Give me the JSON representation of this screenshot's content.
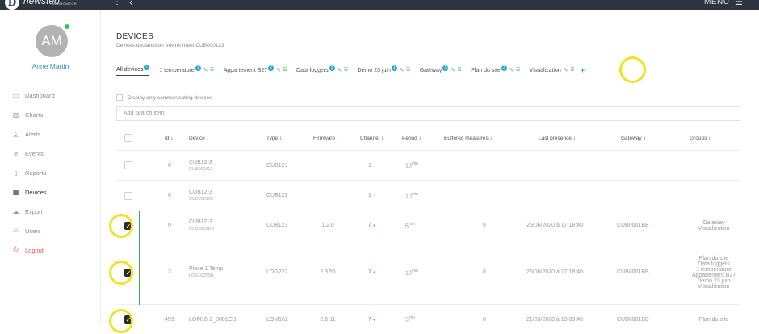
{
  "header": {
    "brand_name": "newsteo",
    "brand_sub": "WEBMONITOR",
    "brand_letter": "D",
    "menu_label": "MENU"
  },
  "user": {
    "initials": "AM",
    "name": "Anne Martin"
  },
  "sidebar": {
    "items": [
      {
        "label": "Dashboard",
        "icon": "monitor-icon"
      },
      {
        "label": "Charts",
        "icon": "bar-chart-icon"
      },
      {
        "label": "Alerts",
        "icon": "bell-icon"
      },
      {
        "label": "Events",
        "icon": "paperclip-icon"
      },
      {
        "label": "Reports",
        "icon": "document-icon"
      },
      {
        "label": "Devices",
        "icon": "grid-icon",
        "active": true
      },
      {
        "label": "Export",
        "icon": "cloud-upload-icon"
      },
      {
        "label": "Users",
        "icon": "user-icon"
      },
      {
        "label": "Logout",
        "icon": "power-icon",
        "danger": true
      }
    ]
  },
  "page": {
    "title": "DEVICES",
    "subtitle": "Devices declared on environment CUB000113"
  },
  "tabs": [
    {
      "label": "All devices",
      "badge": "7",
      "active": true
    },
    {
      "label": "1 temperature",
      "badge": "1"
    },
    {
      "label": "Appartement B27",
      "badge": "2"
    },
    {
      "label": "Data loggers",
      "badge": "3"
    },
    {
      "label": "Demo 23 juin",
      "badge": "1"
    },
    {
      "label": "Gateway",
      "badge": "1"
    },
    {
      "label": "Plan du site",
      "badge": "3"
    },
    {
      "label": "Visualization",
      "badge": ""
    }
  ],
  "filter": {
    "only_communicating_label": "Display only communicating devices",
    "search_placeholder": "Add search item"
  },
  "table": {
    "headers": {
      "id": "Id",
      "device": "Device",
      "type": "Type",
      "firmware": "Firmware",
      "channel": "Channel",
      "period": "Period",
      "buffered": "Buffered measures",
      "last_presence": "Last presence",
      "gateway": "Gateway",
      "groups": "Groups",
      "sort_glyph": "↕"
    },
    "period_unit": "min",
    "rows": [
      {
        "checked": false,
        "id": "0",
        "device": "CUB12-3",
        "serial": "CUB000113",
        "type": "CUB123",
        "firmware": "",
        "channel": "1",
        "channel_ok": false,
        "period": "10",
        "buffered": "",
        "last_presence": "",
        "gateway": "",
        "groups": []
      },
      {
        "checked": false,
        "id": "0",
        "device": "CUB12-3",
        "serial": "CUB000109",
        "type": "CUB123",
        "firmware": "",
        "channel": "1",
        "channel_ok": false,
        "period": "10",
        "buffered": "",
        "last_presence": "",
        "gateway": "",
        "groups": []
      },
      {
        "checked": true,
        "id": "0",
        "device": "CUB12-3",
        "serial": "CUB0001BB",
        "type": "CUB123",
        "firmware": "1.2.0",
        "channel": "7",
        "channel_ok": true,
        "period": "5",
        "buffered": "0",
        "last_presence": "25/06/2020 à 17:18:40",
        "gateway": "CUB0001BB",
        "groups": [
          "Gateway",
          "Visualization"
        ]
      },
      {
        "checked": true,
        "id": "3",
        "device": "Piece 1 Temp.",
        "serial": "LOG00255B",
        "type": "LOG222",
        "firmware": "2.3.56",
        "channel": "7",
        "channel_ok": true,
        "period": "10",
        "buffered": "0",
        "last_presence": "25/06/2020 à 17:18:40",
        "gateway": "CUB0001BB",
        "groups": [
          "Plan du site",
          "Data loggers",
          "1 temperature",
          "Appartement B27",
          "Demo 23 juin",
          "Visualization"
        ]
      },
      {
        "checked": true,
        "id": "459",
        "device": "LOM16-2_0001CB",
        "serial": "",
        "type": "LOM162",
        "firmware": "2.6.11",
        "channel": "7",
        "channel_ok": true,
        "period": "5",
        "buffered": "0",
        "last_presence": "21/03/2020 à 13:03:45",
        "gateway": "CUB0001BB",
        "groups": [
          "Plan du site"
        ]
      }
    ]
  },
  "colors": {
    "topbar": "#2f3540",
    "accent": "#21a7d3",
    "user_name": "#2e8fc7",
    "green": "#41a85f",
    "logout": "#e05555",
    "highlight": "#f4e21a"
  }
}
